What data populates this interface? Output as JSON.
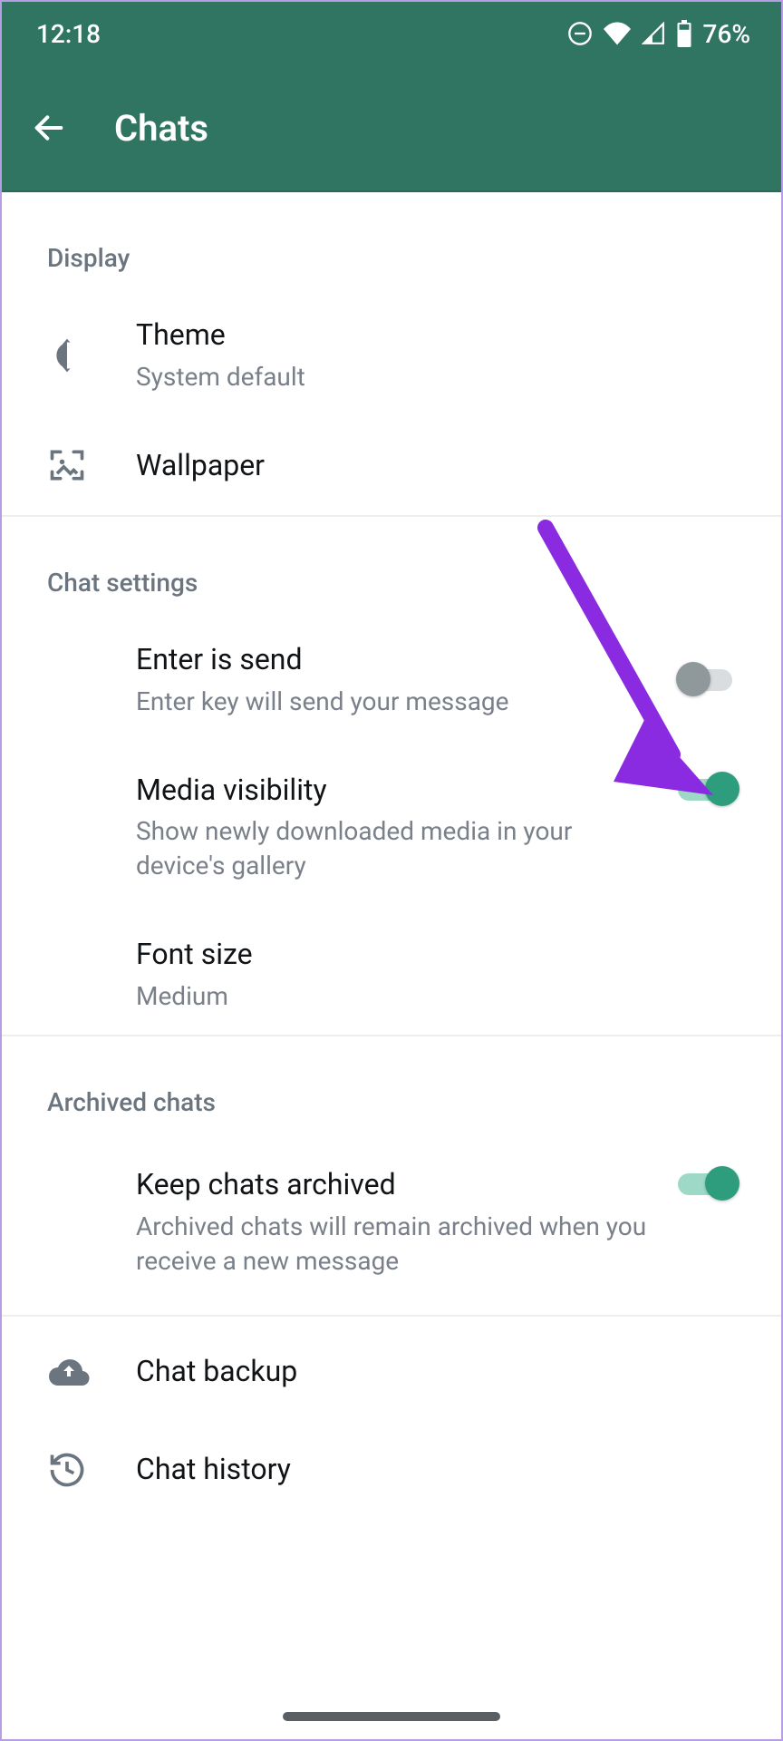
{
  "status": {
    "time": "12:18",
    "battery": "76%"
  },
  "appbar": {
    "title": "Chats"
  },
  "sections": {
    "display": {
      "header": "Display",
      "theme": {
        "title": "Theme",
        "subtitle": "System default"
      },
      "wallpaper": {
        "title": "Wallpaper"
      }
    },
    "chat_settings": {
      "header": "Chat settings",
      "enter_is_send": {
        "title": "Enter is send",
        "subtitle": "Enter key will send your message",
        "on": false
      },
      "media_visibility": {
        "title": "Media visibility",
        "subtitle": "Show newly downloaded media in your device's gallery",
        "on": true
      },
      "font_size": {
        "title": "Font size",
        "subtitle": "Medium"
      }
    },
    "archived": {
      "header": "Archived chats",
      "keep_archived": {
        "title": "Keep chats archived",
        "subtitle": "Archived chats will remain archived when you receive a new message",
        "on": true
      }
    },
    "backup": {
      "title": "Chat backup"
    },
    "history": {
      "title": "Chat history"
    }
  },
  "colors": {
    "accent": "#2e9d7e",
    "appbar": "#2f7561",
    "arrow": "#8a2be2"
  }
}
